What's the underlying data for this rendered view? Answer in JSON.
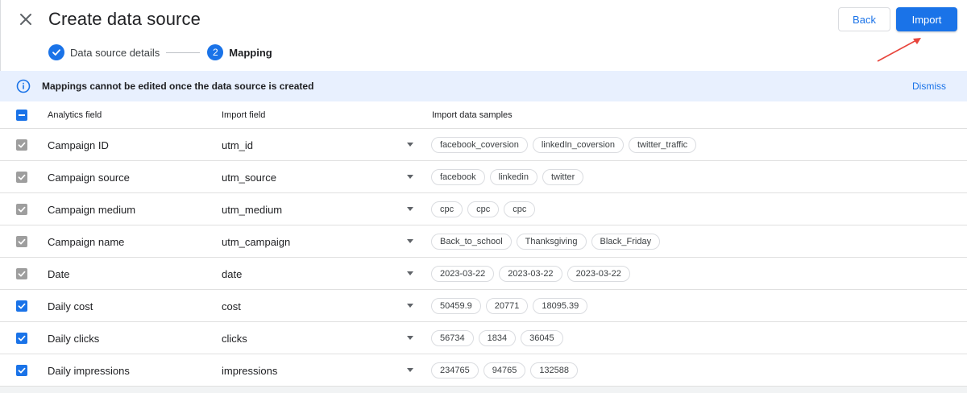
{
  "header": {
    "title": "Create data source",
    "back_label": "Back",
    "import_label": "Import"
  },
  "stepper": {
    "steps": [
      {
        "number": "1",
        "label": "Data source details",
        "state": "completed"
      },
      {
        "number": "2",
        "label": "Mapping",
        "state": "active"
      }
    ]
  },
  "banner": {
    "text": "Mappings cannot be edited once the data source is created",
    "dismiss_label": "Dismiss"
  },
  "table": {
    "headers": {
      "analytics_field": "Analytics field",
      "import_field": "Import field",
      "samples": "Import data samples"
    },
    "rows": [
      {
        "field": "Campaign ID",
        "import": "utm_id",
        "checked": "locked",
        "samples": [
          "facebook_coversion",
          "linkedIn_coversion",
          "twitter_traffic"
        ]
      },
      {
        "field": "Campaign source",
        "import": "utm_source",
        "checked": "locked",
        "samples": [
          "facebook",
          "linkedin",
          "twitter"
        ]
      },
      {
        "field": "Campaign medium",
        "import": "utm_medium",
        "checked": "locked",
        "samples": [
          "cpc",
          "cpc",
          "cpc"
        ]
      },
      {
        "field": "Campaign name",
        "import": "utm_campaign",
        "checked": "locked",
        "samples": [
          "Back_to_school",
          "Thanksgiving",
          "Black_Friday"
        ]
      },
      {
        "field": "Date",
        "import": "date",
        "checked": "locked",
        "samples": [
          "2023-03-22",
          "2023-03-22",
          "2023-03-22"
        ]
      },
      {
        "field": "Daily cost",
        "import": "cost",
        "checked": "checked",
        "samples": [
          "50459.9",
          "20771",
          "18095.39"
        ]
      },
      {
        "field": "Daily clicks",
        "import": "clicks",
        "checked": "checked",
        "samples": [
          "56734",
          "1834",
          "36045"
        ]
      },
      {
        "field": "Daily impressions",
        "import": "impressions",
        "checked": "checked",
        "samples": [
          "234765",
          "94765",
          "132588"
        ]
      }
    ]
  },
  "colors": {
    "accent": "#1a73e8",
    "banner_bg": "#e8f0fe",
    "locked_checkbox": "#9e9e9e",
    "annotation_arrow": "#e8453c"
  },
  "icons": {
    "close": "close-icon",
    "check": "check-icon",
    "info": "info-icon",
    "dropdown": "dropdown-arrow-icon"
  }
}
